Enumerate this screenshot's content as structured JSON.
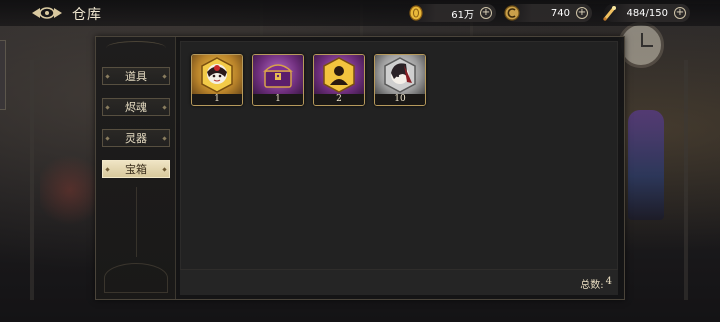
{
  "header": {
    "title": "仓库",
    "resources": [
      {
        "icon": "gold-coin-icon",
        "value": "61万"
      },
      {
        "icon": "spirit-gem-icon",
        "value": "740"
      },
      {
        "icon": "stamina-scroll-icon",
        "value": "484/150"
      }
    ]
  },
  "sidebar": {
    "tabs": [
      {
        "label": "道具",
        "active": false
      },
      {
        "label": "烬魂",
        "active": false
      },
      {
        "label": "灵器",
        "active": false
      },
      {
        "label": "宝箱",
        "active": true
      }
    ]
  },
  "items": [
    {
      "icon": "hero-portrait-chest-icon",
      "count": "1",
      "frame": "gold"
    },
    {
      "icon": "purple-treasure-chest-icon",
      "count": "1",
      "frame": "purple"
    },
    {
      "icon": "silhouette-hero-chest-icon",
      "count": "2",
      "frame": "purple"
    },
    {
      "icon": "silver-hero-portrait-icon",
      "count": "10",
      "frame": "silver"
    }
  ],
  "footer": {
    "total_label": "总数:",
    "total_value": "4"
  },
  "colors": {
    "accent_gold": "#b79a5c",
    "active_tab": "#e6dab5",
    "panel_bg": "#222222"
  }
}
